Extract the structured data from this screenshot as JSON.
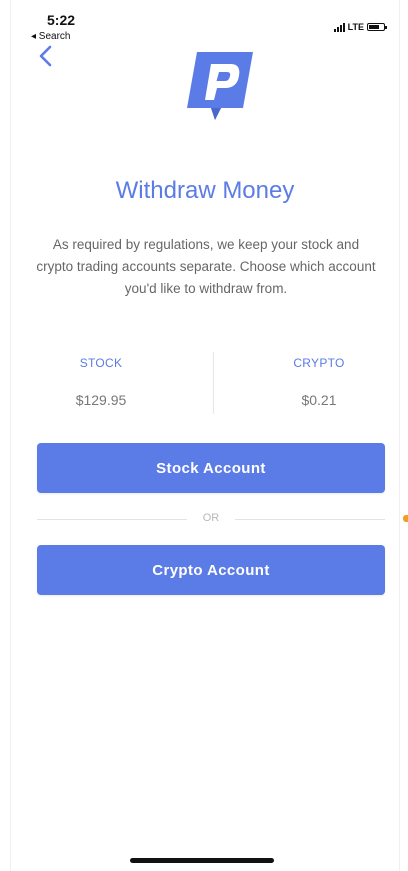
{
  "status_bar": {
    "time": "5:22",
    "back_app": "◂ Search",
    "network": "LTE"
  },
  "page": {
    "title": "Withdraw Money",
    "description": "As required by regulations, we keep your stock and crypto trading accounts separate. Choose which account you'd like to withdraw from."
  },
  "balances": {
    "stock_label": "STOCK",
    "stock_value": "$129.95",
    "crypto_label": "CRYPTO",
    "crypto_value": "$0.21"
  },
  "actions": {
    "stock_button": "Stock Account",
    "separator": "OR",
    "crypto_button": "Crypto Account"
  },
  "colors": {
    "accent": "#5b7be6",
    "text_muted": "#666666",
    "background": "#ffffff"
  },
  "icons": {
    "back": "chevron-left-icon",
    "logo": "app-logo-p"
  }
}
